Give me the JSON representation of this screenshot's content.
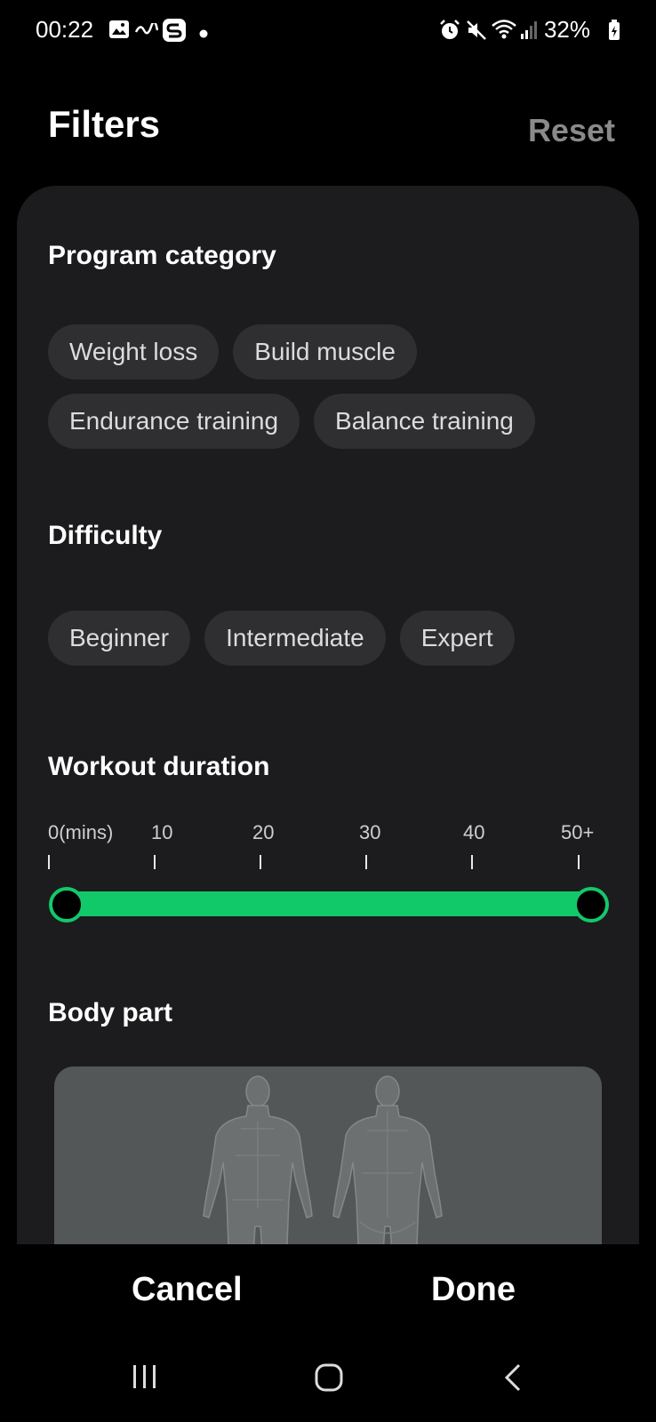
{
  "status_bar": {
    "time": "00:22",
    "battery": "32%"
  },
  "header": {
    "title": "Filters",
    "reset_label": "Reset"
  },
  "program_category": {
    "title": "Program category",
    "chips": [
      "Weight loss",
      "Build muscle",
      "Endurance training",
      "Balance training"
    ]
  },
  "difficulty": {
    "title": "Difficulty",
    "chips": [
      "Beginner",
      "Intermediate",
      "Expert"
    ]
  },
  "workout_duration": {
    "title": "Workout duration",
    "ticks": [
      "0(mins)",
      "10",
      "20",
      "30",
      "40",
      "50+"
    ],
    "range_min": 0,
    "range_max": 50,
    "accent_color": "#12c96a"
  },
  "body_part": {
    "title": "Body part"
  },
  "actions": {
    "cancel_label": "Cancel",
    "done_label": "Done"
  },
  "nav_bar": {
    "icons": [
      "recents-icon",
      "home-icon",
      "back-icon"
    ]
  }
}
